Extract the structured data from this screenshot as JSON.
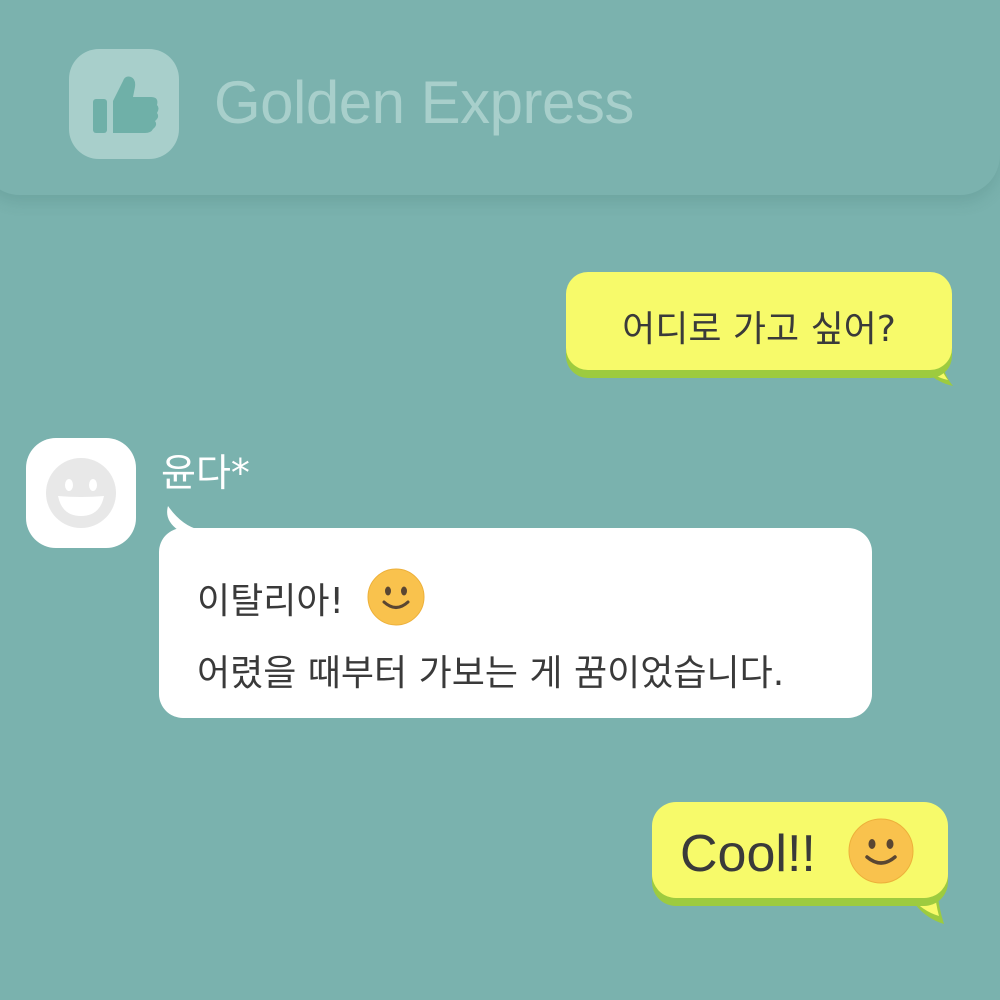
{
  "header": {
    "app_title": "Golden Express",
    "app_icon": "thumbs-up-icon"
  },
  "messages": [
    {
      "side": "right",
      "text": "어디로 가고 싶어?"
    },
    {
      "side": "left",
      "sender": "윤다*",
      "avatar_icon": "smiley-avatar-icon",
      "lines": [
        "이탈리아!",
        "어렸을 때부터 가보는 게 꿈이었습니다."
      ],
      "emoji": "smiling-face-emoji"
    },
    {
      "side": "right",
      "text": "Cool!!",
      "emoji": "smiling-face-emoji"
    }
  ],
  "colors": {
    "background": "#7AB2AE",
    "my_bubble": "#F7FA6A",
    "my_bubble_shadow": "#9DCB3F",
    "other_bubble": "#FFFFFF",
    "emoji": "#F9C24D"
  }
}
